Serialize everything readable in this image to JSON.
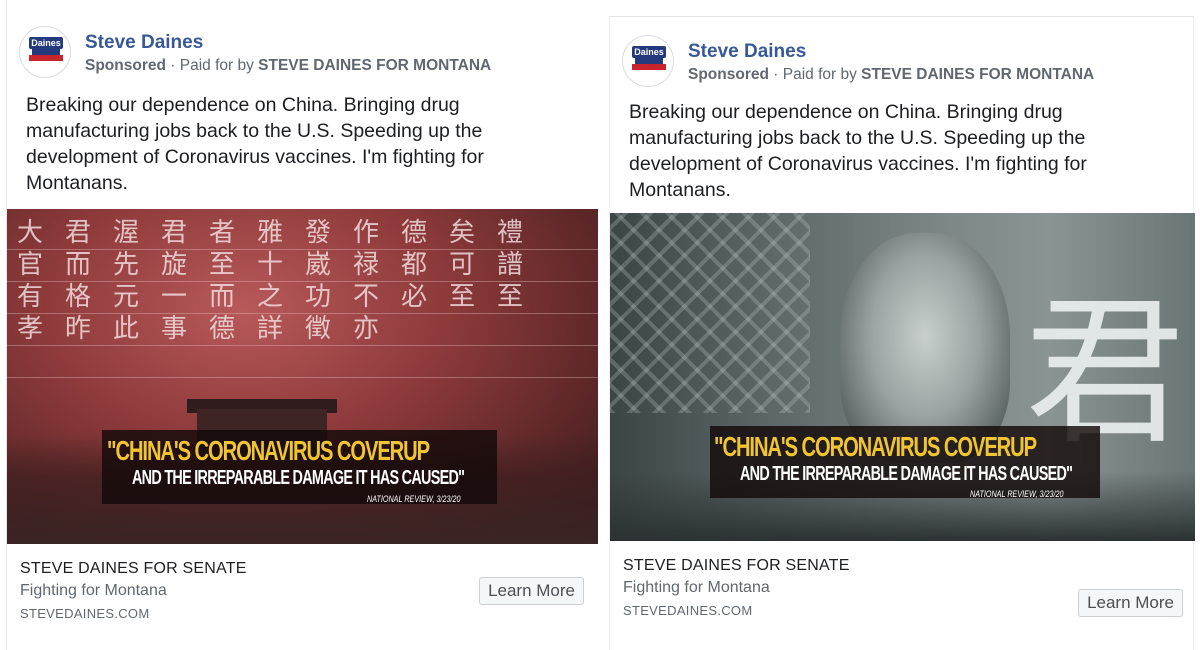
{
  "ads": [
    {
      "page_name": "Steve Daines",
      "sponsored_label": "Sponsored",
      "paid_for_prefix": "Paid for by",
      "paid_for_entity": "STEVE DAINES FOR MONTANA",
      "avatar_logo_text": "Daines",
      "body": "Breaking our dependence on China. Bringing drug manufacturing jobs back to the U.S. Speeding up the development of Coronavirus vaccines. I'm fighting for Montanans.",
      "image_background_glyphs": "大君渥君者雅發作德矣禮官而先旋至十崴禄都可譜有格元一而之功不必至至孝昨此事德詳徵亦",
      "quote_line_1": "\"CHINA'S CORONAVIRUS COVERUP",
      "quote_line_2": "AND THE IRREPARABLE DAMAGE IT HAS CAUSED\"",
      "quote_source": "NATIONAL REVIEW, 3/23/20",
      "footer_title": "STEVE DAINES FOR SENATE",
      "footer_subtitle": "Fighting for Montana",
      "footer_domain": "STEVEDAINES.COM",
      "cta_label": "Learn More"
    },
    {
      "page_name": "Steve Daines",
      "sponsored_label": "Sponsored",
      "paid_for_prefix": "Paid for by",
      "paid_for_entity": "STEVE DAINES FOR MONTANA",
      "avatar_logo_text": "Daines",
      "body": "Breaking our dependence on China. Bringing drug manufacturing jobs back to the U.S. Speeding up the development of Coronavirus vaccines. I'm fighting for Montanans.",
      "image_background_glyphs": "君",
      "quote_line_1": "\"CHINA'S CORONAVIRUS COVERUP",
      "quote_line_2": "AND THE IRREPARABLE DAMAGE IT HAS CAUSED\"",
      "quote_source": "NATIONAL REVIEW, 3/23/20",
      "footer_title": "STEVE DAINES FOR SENATE",
      "footer_subtitle": "Fighting for Montana",
      "footer_domain": "STEVEDAINES.COM",
      "cta_label": "Learn More"
    }
  ],
  "colors": {
    "page_name": "#385898",
    "quote_yellow": "#f1c531",
    "secondary_text": "#606770"
  }
}
